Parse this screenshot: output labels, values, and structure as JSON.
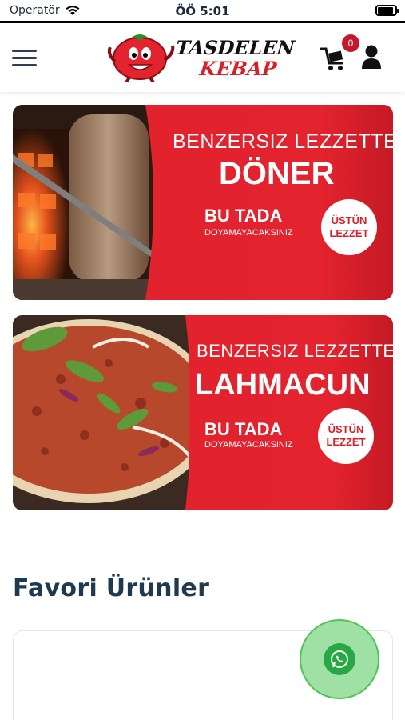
{
  "status_bar": {
    "carrier": "Operatör",
    "time": "ÖÖ 5:01"
  },
  "header": {
    "logo_line1": "TASDELEN",
    "logo_line2": "KEBAP",
    "cart_count": "0"
  },
  "banners": [
    {
      "line1": "BENZERSIZ LEZZETTE",
      "product": "DÖNER",
      "tagline": "BU TADA",
      "subline": "DOYAMAYACAKSINIZ",
      "badge_line1": "ÜSTÜN",
      "badge_line2": "LEZZET"
    },
    {
      "line1": "BENZERSIZ LEZZETTE",
      "product": "LAHMACUN",
      "tagline": "BU TADA",
      "subline": "DOYAMAYACAKSINIZ",
      "badge_line1": "ÜSTÜN",
      "badge_line2": "LEZZET"
    }
  ],
  "sections": {
    "favorites_title": "Favori Ürünler"
  },
  "colors": {
    "brand_red": "#e2222d",
    "title_navy": "#1f3a4f",
    "whatsapp_green": "#27a844"
  },
  "icons": [
    "wifi-icon",
    "battery-icon",
    "menu-icon",
    "cart-icon",
    "user-icon",
    "whatsapp-icon"
  ]
}
